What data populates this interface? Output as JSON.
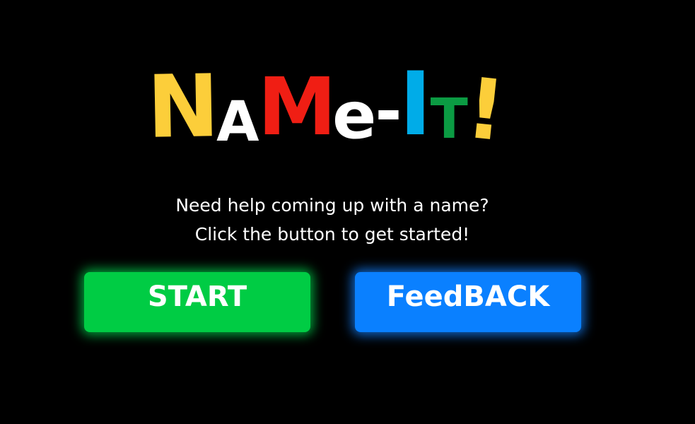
{
  "logo": {
    "letters": [
      {
        "char": "N",
        "color": "#fcce3a"
      },
      {
        "char": "A",
        "color": "#ffffff"
      },
      {
        "char": "M",
        "color": "#f01e14"
      },
      {
        "char": "e",
        "color": "#ffffff"
      },
      {
        "char": "-",
        "color": "#ffffff"
      },
      {
        "char": "I",
        "color": "#00ace8"
      },
      {
        "char": "T",
        "color": "#0b9b43"
      },
      {
        "char": "!",
        "color": "#fcce3a"
      }
    ]
  },
  "tagline": {
    "line1": "Need help coming up with a name?",
    "line2": "Click the button to get started!"
  },
  "buttons": {
    "start_label": "START",
    "feedback_label": "FeedBACK",
    "start_color": "#00cc44",
    "feedback_color": "#0a80ff"
  }
}
